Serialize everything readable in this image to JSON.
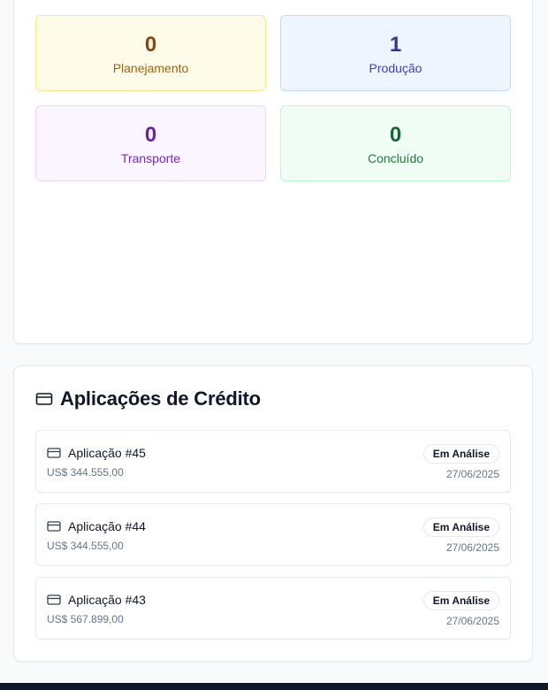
{
  "stats": [
    {
      "value": "0",
      "label": "Planejamento"
    },
    {
      "value": "1",
      "label": "Produção"
    },
    {
      "value": "0",
      "label": "Transporte"
    },
    {
      "value": "0",
      "label": "Concluído"
    }
  ],
  "credit": {
    "title": "Aplicações de Crédito",
    "icon": "credit-card-icon",
    "applications": [
      {
        "name": "Aplicação #45",
        "amount": "US$ 344.555,00",
        "status": "Em Análise",
        "date": "27/06/2025"
      },
      {
        "name": "Aplicação #44",
        "amount": "US$ 344.555,00",
        "status": "Em Análise",
        "date": "27/06/2025"
      },
      {
        "name": "Aplicação #43",
        "amount": "US$ 567.899,00",
        "status": "Em Análise",
        "date": "27/06/2025"
      }
    ]
  }
}
